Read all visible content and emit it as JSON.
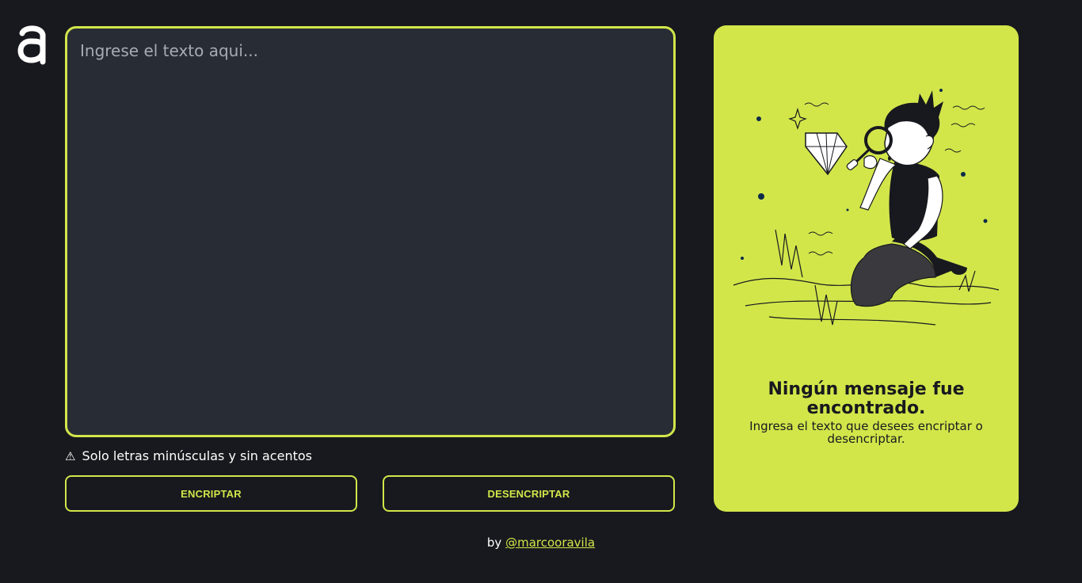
{
  "logo": {
    "icon": "logo-a-icon"
  },
  "editor": {
    "placeholder": "Ingrese el texto aqui...",
    "value": ""
  },
  "hint": {
    "icon": "warning-icon",
    "glyph": "⚠",
    "text": "Solo letras minúsculas y sin acentos"
  },
  "buttons": {
    "encrypt": "ENCRIPTAR",
    "decrypt": "DESENCRIPTAR"
  },
  "panel": {
    "title": "Ningún mensaje fue encontrado.",
    "subtitle": "Ingresa el texto que desees encriptar o desencriptar.",
    "illustration": "person-with-magnifying-glass-illustration"
  },
  "footer": {
    "prefix": "by",
    "handle": "@marcooravila"
  },
  "colors": {
    "background": "#18191e",
    "accent": "#d2e64a",
    "editor_bg": "#282c35"
  }
}
